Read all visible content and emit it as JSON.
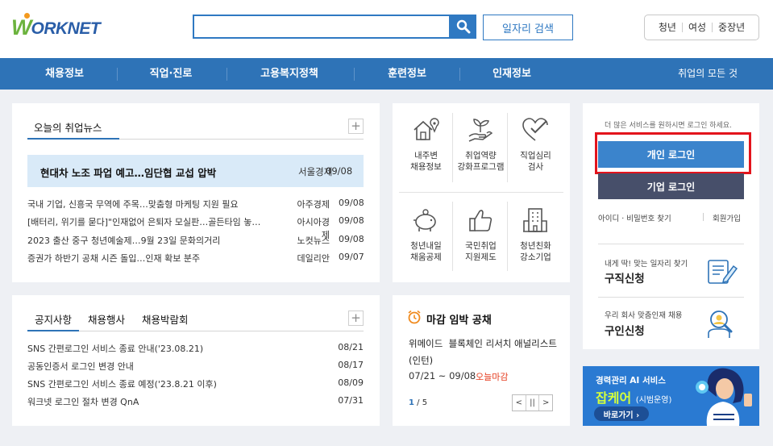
{
  "header": {
    "logo_first": "W",
    "logo_rest": "ORKNET",
    "search_placeholder": "",
    "job_search_label": "일자리 검색",
    "user_groups": [
      "청년",
      "여성",
      "중장년"
    ]
  },
  "nav": {
    "items": [
      "채용정보",
      "직업·진로",
      "고용복지정책",
      "훈련정보",
      "인재정보"
    ],
    "all_label": "취업의 모든 것"
  },
  "news": {
    "title": "오늘의 취업뉴스",
    "headline": {
      "title": "현대차 노조 파업 예고…임단협 교섭 압박",
      "source": "서울경제",
      "date": "09/08"
    },
    "items": [
      {
        "title": "국내 기업, 신흥국 무역에 주목…맞춤형 마케팅 지원 필요",
        "source": "아주경제",
        "date": "09/08"
      },
      {
        "title": "[배터리, 위기를 묻다]\"인재없어 은퇴자 모실판…골든타임 놓…",
        "source": "아시아경제",
        "date": "09/08"
      },
      {
        "title": "2023 출산 중구 청년예술제…9월 23일 문화의거리",
        "source": "노컷뉴스",
        "date": "09/08"
      },
      {
        "title": "증권가 하반기 공채 시즌 돌입…인재 확보 분주",
        "source": "데일리안",
        "date": "09/07"
      }
    ]
  },
  "notice": {
    "tabs": [
      "공지사항",
      "채용행사",
      "채용박람회"
    ],
    "items": [
      {
        "title": "SNS 간편로그인 서비스 종료 안내('23.08.21)",
        "date": "08/21"
      },
      {
        "title": "공동인증서 로그인 변경 안내",
        "date": "08/17"
      },
      {
        "title": "SNS 간편로그인 서비스 종료 예정('23.8.21 이후)",
        "date": "08/09"
      },
      {
        "title": "워크넷 로그인 절차 변경 QnA",
        "date": "07/31"
      }
    ]
  },
  "services": [
    {
      "line1": "내주변",
      "line2": "채용정보",
      "icon": "house-map-icon"
    },
    {
      "line1": "취업역량",
      "line2": "강화프로그램",
      "icon": "sprout-hand-icon"
    },
    {
      "line1": "직업심리",
      "line2": "검사",
      "icon": "heart-check-icon"
    },
    {
      "line1": "청년내일",
      "line2": "채움공제",
      "icon": "piggy-bank-icon"
    },
    {
      "line1": "국민취업",
      "line2": "지원제도",
      "icon": "thumbs-up-icon"
    },
    {
      "line1": "청년친화",
      "line2": "강소기업",
      "icon": "building-icon"
    }
  ],
  "deadline": {
    "title": "마감 임박 공채",
    "company": "위메이드",
    "job": "블록체인 리서치 애널리스트(인턴)",
    "period": "07/21 ~ 09/08",
    "tag": "오늘마감",
    "page_current": "1",
    "page_total": "/ 5"
  },
  "login": {
    "message": "더 많은 서비스를 원하시면 로그인 하세요.",
    "personal_label": "개인 로그인",
    "corporate_label": "기업 로그인",
    "find_label": "아이디 · 비밀번호 찾기",
    "join_label": "회원가입",
    "job_apply_sub": "내게 딱! 맞는 일자리 찾기",
    "job_apply_main": "구직신청",
    "hire_apply_sub": "우리 회사 맞춤인재 채용",
    "hire_apply_main": "구인신청"
  },
  "banner": {
    "line1": "경력관리 AI 서비스",
    "name": "잡케어",
    "note": "(시범운영)",
    "go_label": "바로가기 ›"
  },
  "colors": {
    "brand_blue": "#2e73b7",
    "brand_green": "#6cb33e",
    "highlight_red": "#e3141c",
    "deadline_red": "#e53b1d"
  }
}
